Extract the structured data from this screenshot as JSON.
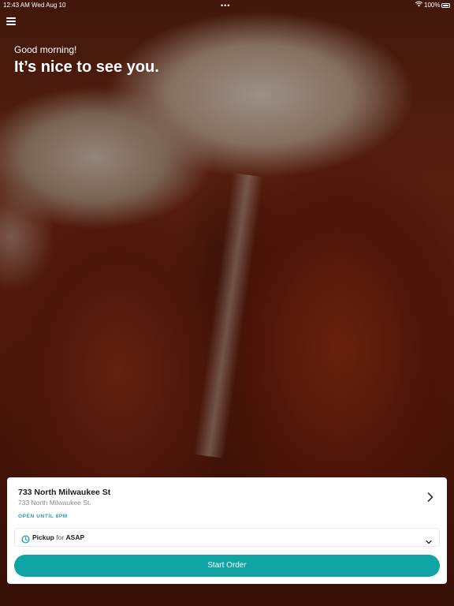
{
  "status_bar": {
    "time": "12:43 AM",
    "date": "Wed Aug 10",
    "battery": "100%"
  },
  "greeting": {
    "small": "Good morning!",
    "headline": "It’s nice to see you."
  },
  "store": {
    "name": "733 North Milwaukee St",
    "address": "733 North Milwaukee St.",
    "hours": "OPEN UNTIL 8PM"
  },
  "order": {
    "method": "Pickup",
    "for_word": "for",
    "time": "ASAP",
    "start_label": "Start Order"
  },
  "colors": {
    "accent": "#0fa5a5",
    "hours_text": "#2a9ea0",
    "clock_icon": "#2a9ea0"
  },
  "icons": {
    "menu": "hamburger-menu-icon",
    "store_chevron": "chevron-right-icon",
    "pickup_clock": "clock-icon",
    "pickup_chevron": "chevron-down-icon"
  }
}
